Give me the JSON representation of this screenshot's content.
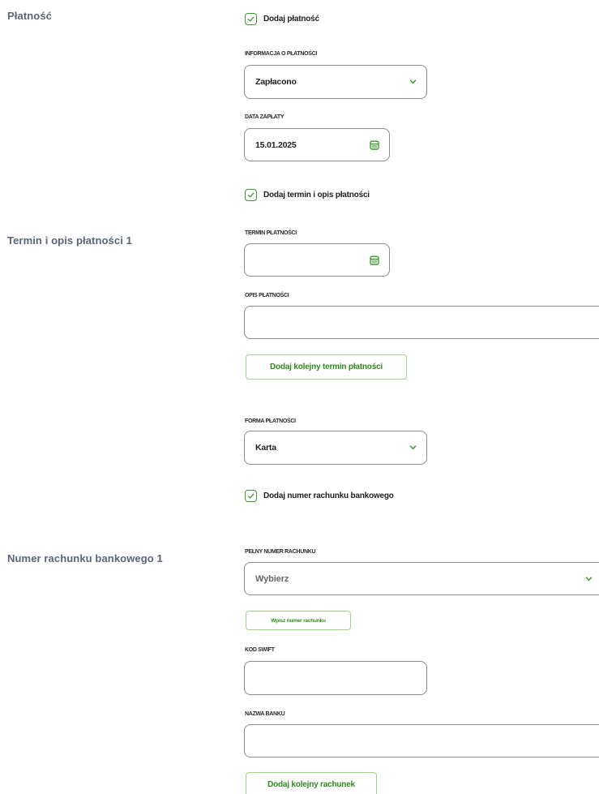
{
  "payment": {
    "section_title": "Płatność",
    "add_payment_label": "Dodaj płatność",
    "payment_info_label": "INFORMACJA O PŁATNOŚCI",
    "payment_info_value": "Zapłacono",
    "payment_date_label": "DATA ZAPŁATY",
    "payment_date_value": "15.01.2025",
    "add_term_label": "Dodaj termin i opis płatności"
  },
  "term": {
    "section_title": "Termin i opis płatności 1",
    "due_date_label": "TERMIN PŁATNOŚCI",
    "due_date_value": "",
    "description_label": "OPIS PŁATNOŚCI",
    "description_value": "",
    "add_next_term_button": "Dodaj kolejny termin płatności"
  },
  "payment_form": {
    "label": "FORMA PŁATNOŚCI",
    "value": "Karta",
    "add_account_label": "Dodaj numer rachunku bankowego"
  },
  "bank_account": {
    "section_title": "Numer rachunku bankowego 1",
    "full_number_label": "PEŁNY NUMER RACHUNKU",
    "full_number_placeholder": "Wybierz",
    "enter_number_button": "Wpisz numer rachunku",
    "swift_label": "KOD SWIFT",
    "swift_value": "",
    "bank_name_label": "NAZWA BANKU",
    "bank_name_value": "",
    "add_next_account_button": "Dodaj kolejny rachunek"
  },
  "colors": {
    "accent_green": "#3e9a2d",
    "button_border": "#9fd08f",
    "section_title": "#5a6478",
    "input_border": "#8a8a8a"
  },
  "icons": {
    "checkbox": "checkmark-icon",
    "dropdown": "chevron-down-icon",
    "date": "calendar-icon"
  }
}
